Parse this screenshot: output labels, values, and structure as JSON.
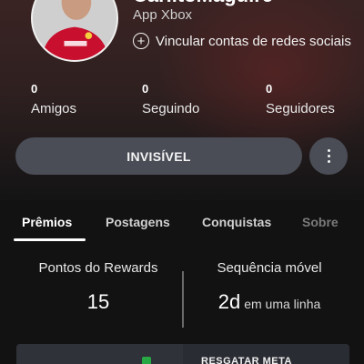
{
  "profile": {
    "gamertag": "CarlitoMaguire",
    "app_label": "App Xbox",
    "link_accounts": "Vincular contas de redes sociais",
    "avatar": "soccer-player-avatar"
  },
  "stats": [
    {
      "count": "0",
      "label": "Amigos"
    },
    {
      "count": "0",
      "label": "Seguindo"
    },
    {
      "count": "0",
      "label": "Seguidores"
    }
  ],
  "actions": {
    "presence_label": "INVISÍVEL",
    "more_icon": "more-vertical-icon"
  },
  "tabs": [
    {
      "label": "Prêmios",
      "active": true
    },
    {
      "label": "Postagens"
    },
    {
      "label": "Conquistas"
    },
    {
      "label": "Sobre"
    }
  ],
  "rewards": {
    "points_title": "Pontos do Rewards",
    "points_value": "15",
    "streak_title": "Sequência móvel",
    "streak_value": "2d",
    "streak_suffix": "em uma linha"
  },
  "card": {
    "text": "RESGATAR META"
  },
  "colors": {
    "background": "#121212",
    "button": "#4a4d56",
    "accent_green": "#28a745"
  }
}
